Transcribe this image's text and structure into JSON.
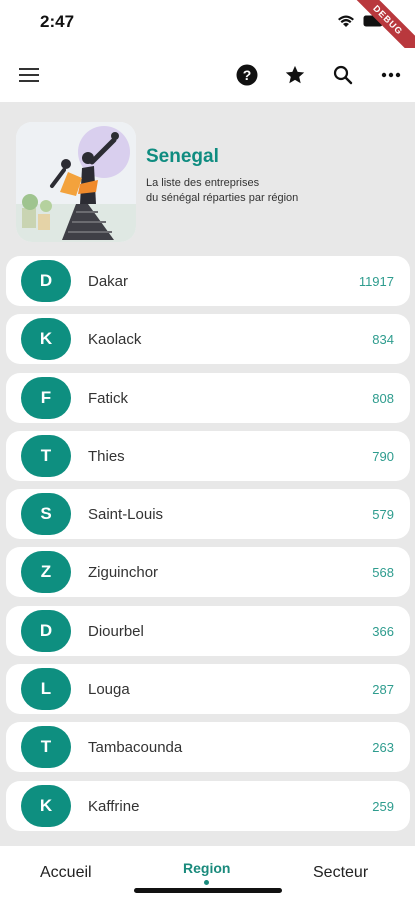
{
  "status": {
    "time": "2:47",
    "debug": "DEBUG"
  },
  "app_bar": {
    "icons": [
      "menu-icon",
      "help-icon",
      "star-icon",
      "search-icon",
      "more-icon"
    ]
  },
  "header": {
    "title": "Senegal",
    "subtitle_line1": "La liste des entreprises",
    "subtitle_line2": "du sénégal réparties par région"
  },
  "regions": [
    {
      "letter": "D",
      "name": "Dakar",
      "count": "11917"
    },
    {
      "letter": "K",
      "name": "Kaolack",
      "count": "834"
    },
    {
      "letter": "F",
      "name": "Fatick",
      "count": "808"
    },
    {
      "letter": "T",
      "name": "Thies",
      "count": "790"
    },
    {
      "letter": "S",
      "name": "Saint-Louis",
      "count": "579"
    },
    {
      "letter": "Z",
      "name": "Ziguinchor",
      "count": "568"
    },
    {
      "letter": "D",
      "name": "Diourbel",
      "count": "366"
    },
    {
      "letter": "L",
      "name": "Louga",
      "count": "287"
    },
    {
      "letter": "T",
      "name": "Tambacounda",
      "count": "263"
    },
    {
      "letter": "K",
      "name": "Kaffrine",
      "count": "259"
    }
  ],
  "nav": {
    "accueil": "Accueil",
    "region": "Region",
    "secteur": "Secteur"
  },
  "colors": {
    "accent": "#0e8f80",
    "count": "#2e9c8e",
    "debug": "#b9383d"
  }
}
